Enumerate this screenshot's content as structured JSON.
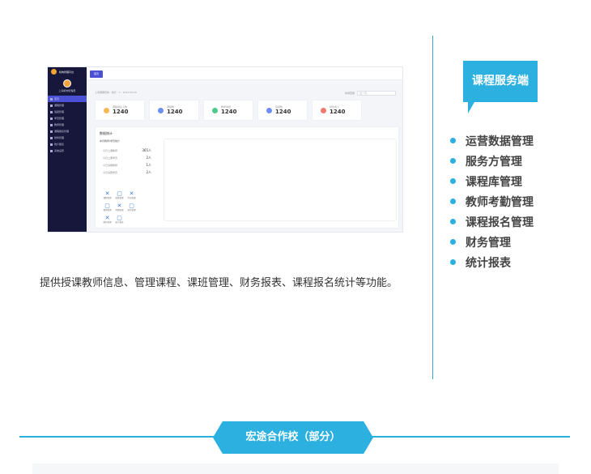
{
  "screenshot": {
    "sidebar": {
      "logo_text": "机构管理平台",
      "user": "上海机构管理员",
      "menu": [
        "首页",
        "课程管理",
        "班级管理",
        "学员管理",
        "教师管理",
        "课程报名管理",
        "财务管理",
        "统计报表",
        "系统设置"
      ]
    },
    "top_tab": "首页",
    "breadcrumb": "上海课服机构 · 统计：1 · 2024-05-20",
    "filter": {
      "label": "时间范围",
      "value": "近一月"
    },
    "stats": [
      {
        "label": "课程报名人数",
        "value": "1240",
        "color": "#f7b955"
      },
      {
        "label": "课程数",
        "value": "1240",
        "color": "#6d8ff0"
      },
      {
        "label": "教师考勤",
        "value": "1240",
        "color": "#4cc98b"
      },
      {
        "label": "班级数",
        "value": "1240",
        "color": "#6d8ff0"
      },
      {
        "label": "财务收入",
        "value": "1240",
        "color": "#f07a6d"
      }
    ],
    "panel": {
      "title": "数据统计",
      "subtitle": "本月教师/学员统计",
      "metrics": [
        {
          "label": "今日上课教师",
          "value": "365人"
        },
        {
          "label": "今日上课学员",
          "value": "2人"
        },
        {
          "label": "今日请假教师",
          "value": "1人"
        },
        {
          "label": "今日请假学员",
          "value": "2人"
        }
      ],
      "mini_items": [
        {
          "glyph": "✕",
          "label": "课程管理"
        },
        {
          "glyph": "▢",
          "label": "班级管理"
        },
        {
          "glyph": "✕",
          "label": "学员管理"
        },
        {
          "glyph": "▢",
          "label": "教师管理"
        },
        {
          "glyph": "✕",
          "label": "考勤管理"
        },
        {
          "glyph": "▢",
          "label": "财务管理"
        },
        {
          "glyph": "✕",
          "label": "报名管理"
        },
        {
          "glyph": "▢",
          "label": "统计报表"
        }
      ]
    }
  },
  "description": "提供授课教师信息、管理课程、课班管理、财务报表、课程报名统计等功能。",
  "badge": "课程服务端",
  "features": [
    "运营数据管理",
    "服务方管理",
    "课程库管理",
    "教师考勤管理",
    "课程报名管理",
    "财务管理",
    "统计报表"
  ],
  "banner": "宏途合作校（部分）",
  "colors": {
    "accent": "#2bb0e0",
    "divider": "#3fa7d6",
    "sidebar": "#16173a",
    "primary": "#4b50d4"
  }
}
